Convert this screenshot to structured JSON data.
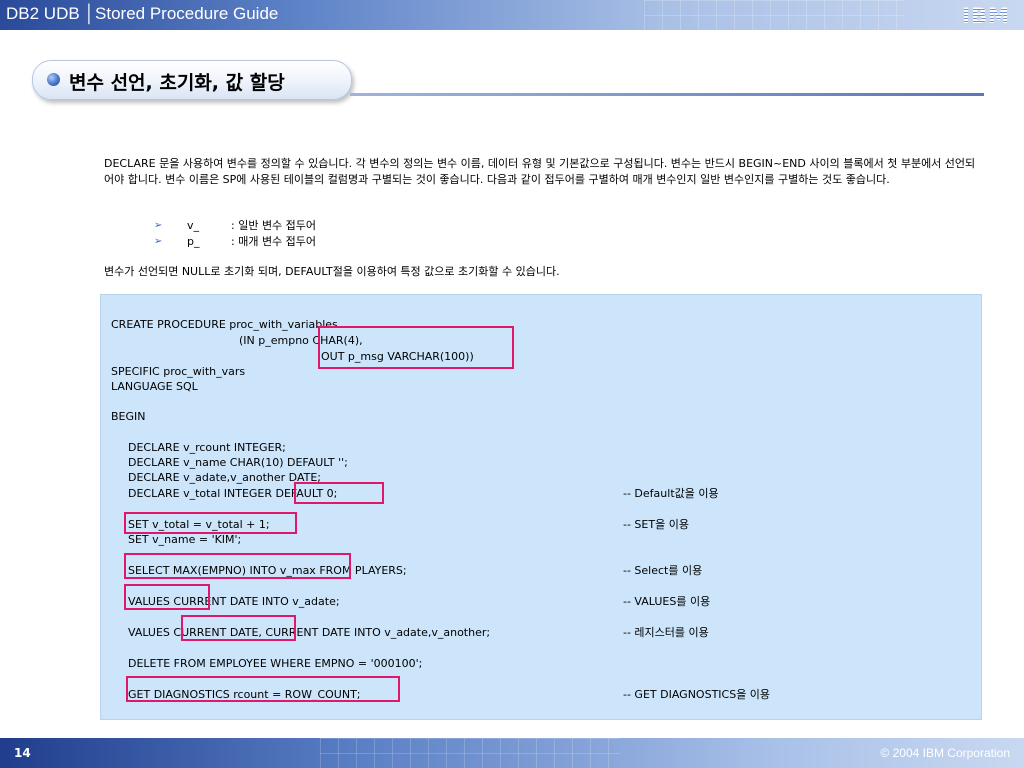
{
  "header": {
    "title": "DB2 UDB │Stored Procedure Guide",
    "logo": "IBM"
  },
  "section": {
    "title": "변수 선언, 초기화, 값 할당"
  },
  "intro": {
    "paragraph": "DECLARE 문을 사용하여 변수를 정의할 수 있습니다. 각 변수의 정의는 변수 이름, 데이터 유형 및 기본값으로 구성됩니다. 변수는 반드시 BEGIN~END 사이의 블록에서 첫 부분에서 선언되어야 합니다. 변수 이름은 SP에 사용된 테이블의 컬럼명과 구별되는 것이 좋습니다. 다음과 같이 접두어를 구별하여 매개 변수인지 일반 변수인지를 구별하는 것도 좋습니다.",
    "bullets": [
      {
        "marker": "➢",
        "name": "v_",
        "desc": ": 일반 변수 접두어"
      },
      {
        "marker": "➢",
        "name": "p_",
        "desc": ": 매개 변수 접두어"
      }
    ],
    "after": "변수가 선언되면 NULL로 초기화 되며, DEFAULT절을 이용하여 특정 값으로 초기화할 수 있습니다."
  },
  "code": {
    "lines": [
      "CREATE PROCEDURE proc_with_variables",
      "(IN p_empno CHAR(4),",
      "OUT p_msg   VARCHAR(100))",
      "SPECIFIC proc_with_vars",
      "LANGUAGE SQL",
      "BEGIN",
      "DECLARE v_rcount INTEGER;",
      "DECLARE v_name CHAR(10) DEFAULT '';",
      "DECLARE v_adate,v_another DATE;",
      "DECLARE v_total INTEGER DEFAULT 0;",
      "SET v_total = v_total + 1;",
      "SET v_name = 'KIM';",
      "SELECT MAX(EMPNO) INTO v_max FROM PLAYERS;",
      "VALUES CURRENT DATE INTO v_adate;",
      "VALUES CURRENT DATE, CURRENT DATE INTO v_adate,v_another;",
      "DELETE FROM EMPLOYEE WHERE EMPNO = '000100';",
      "GET DIAGNOSTICS rcount = ROW_COUNT;"
    ],
    "comments": [
      "-- Default값을 이용",
      "-- SET을 이용",
      "-- Select를 이용",
      "-- VALUES를 이용",
      "-- 레지스터를 이용",
      "-- GET DIAGNOSTICS을 이용"
    ],
    "highlight_color": "#e0186a"
  },
  "footer": {
    "page": "14",
    "copyright": "© 2004 IBM Corporation"
  }
}
